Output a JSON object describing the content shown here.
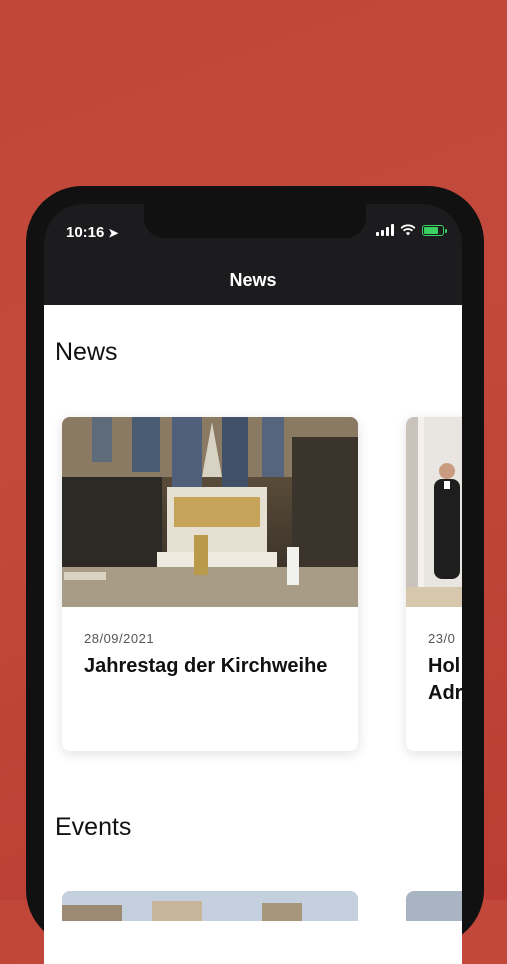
{
  "status_bar": {
    "time": "10:16"
  },
  "nav": {
    "title": "News"
  },
  "sections": {
    "news_heading": "News",
    "events_heading": "Events"
  },
  "news_cards": [
    {
      "date": "28/09/2021",
      "title": "Jahrestag der Kirchweihe"
    },
    {
      "date": "23/0",
      "title": "Hol Adr"
    }
  ],
  "colors": {
    "background_red": "#c0463a",
    "nav_bar": "#1c1c1e",
    "battery_green": "#3ad163"
  }
}
